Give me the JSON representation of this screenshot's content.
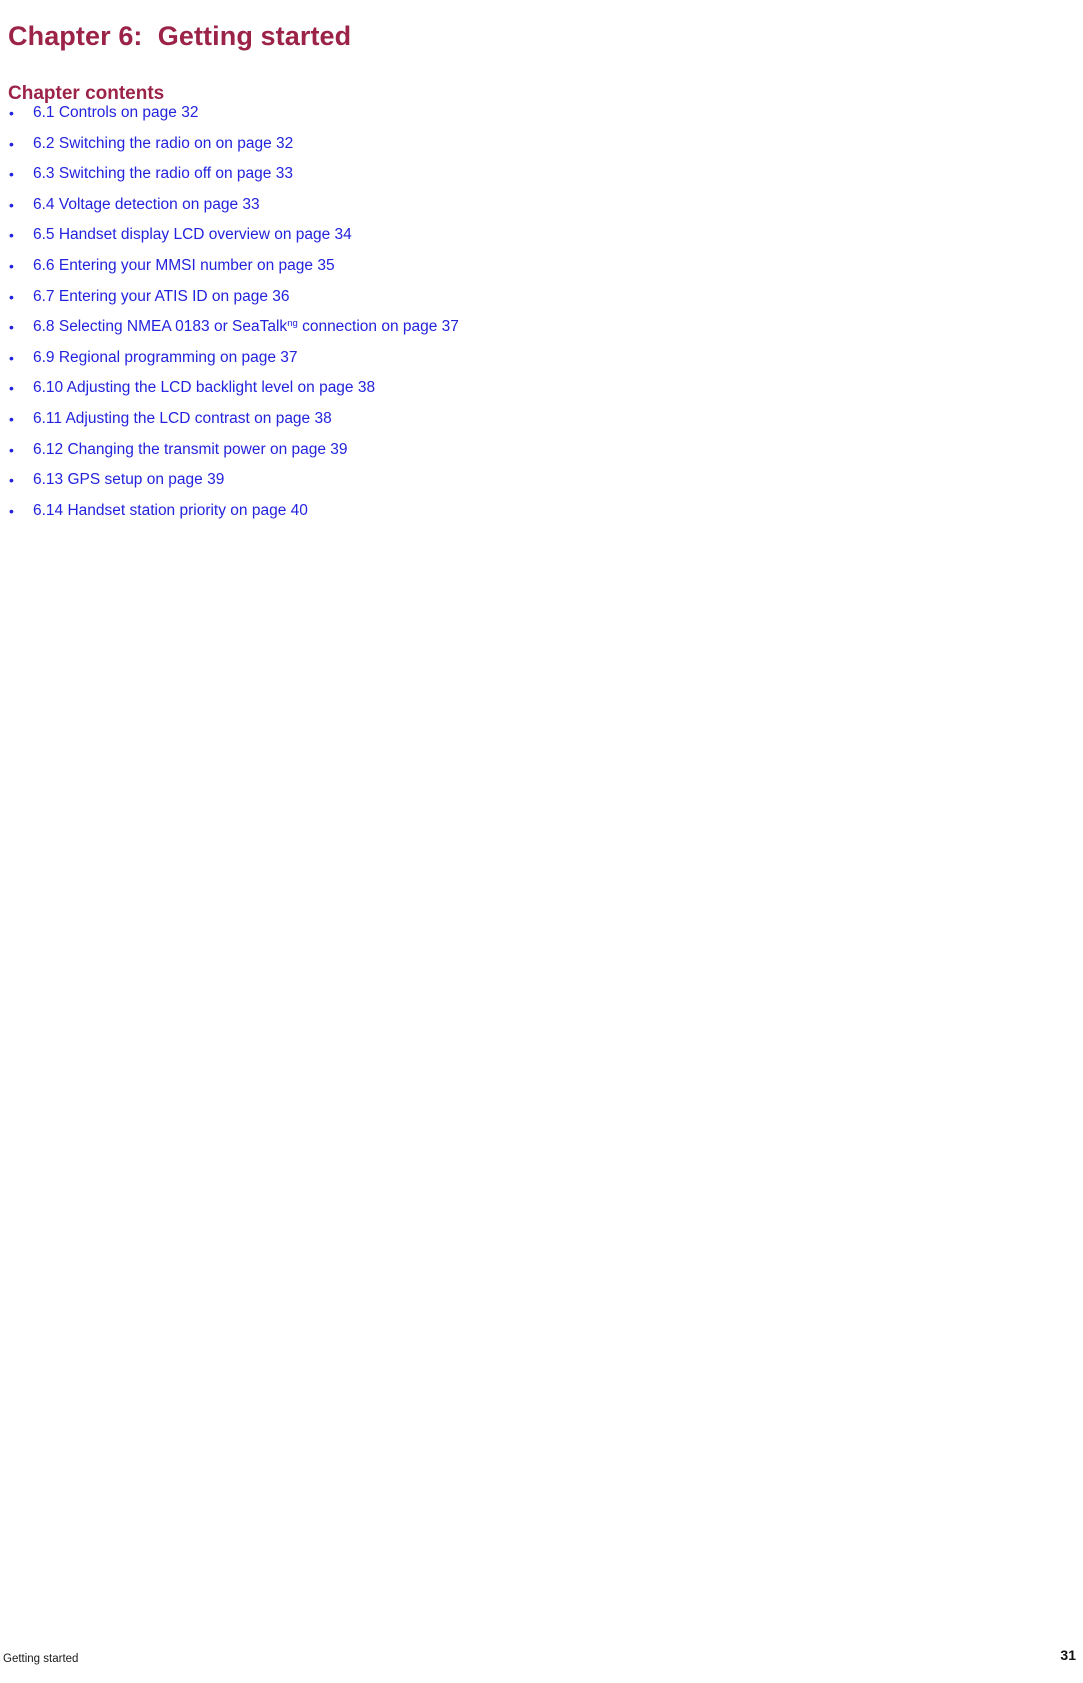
{
  "document": {
    "chapter_title": "Chapter 6:  Getting started",
    "contents_heading": "Chapter contents",
    "title_color": "#9C2348",
    "link_color": "#2323DD"
  },
  "contents": {
    "items": [
      {
        "number": "6.1",
        "text": "6.1 Controls on page 32"
      },
      {
        "number": "6.2",
        "text": "6.2 Switching the radio on on page 32"
      },
      {
        "number": "6.3",
        "text": "6.3 Switching the radio off on page 33"
      },
      {
        "number": "6.4",
        "text": "6.4 Voltage detection on page 33"
      },
      {
        "number": "6.5",
        "text": "6.5 Handset display LCD overview on page 34"
      },
      {
        "number": "6.6",
        "text": "6.6 Entering your MMSI number on page 35"
      },
      {
        "number": "6.7",
        "text": "6.7 Entering your ATIS ID on page 36"
      },
      {
        "number": "6.8",
        "text_before": "6.8 Selecting NMEA 0183 or SeaTalk",
        "superscript": "ng",
        "text_after": " connection on page 37"
      },
      {
        "number": "6.9",
        "text": "6.9 Regional programming on page 37"
      },
      {
        "number": "6.10",
        "text": "6.10 Adjusting the LCD backlight level on page 38"
      },
      {
        "number": "6.11",
        "text": "6.11 Adjusting the LCD contrast on page 38"
      },
      {
        "number": "6.12",
        "text": "6.12 Changing the transmit power on page 39"
      },
      {
        "number": "6.13",
        "text": "6.13 GPS setup on page 39"
      },
      {
        "number": "6.14",
        "text": "6.14 Handset station priority on page 40"
      }
    ],
    "bullet_glyph": "•"
  },
  "footer": {
    "section_label": "Getting started",
    "page_number": "31"
  }
}
